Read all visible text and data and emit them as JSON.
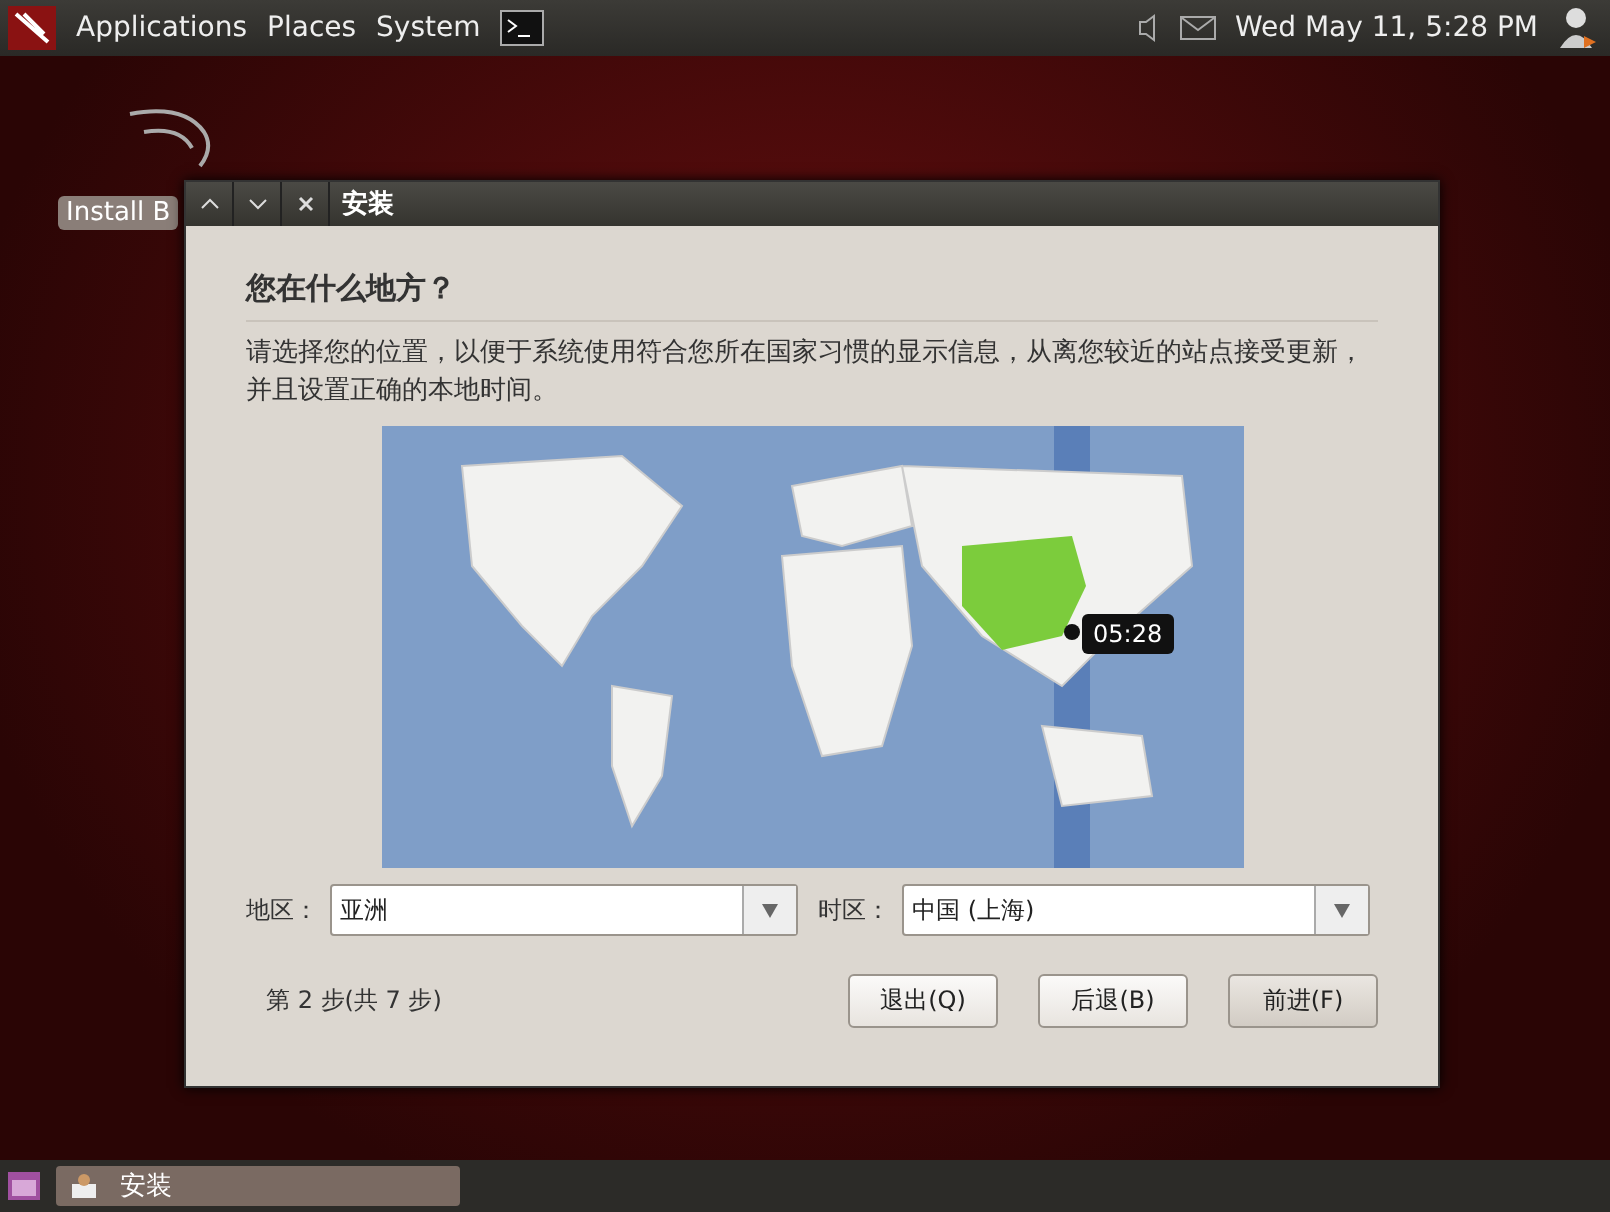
{
  "top_panel": {
    "menus": [
      "Applications",
      "Places",
      "System"
    ],
    "clock": "Wed May 11,  5:28 PM"
  },
  "desktop": {
    "icon_label": "Install B"
  },
  "window": {
    "title": "安装",
    "heading": "您在什么地方？",
    "description": "请选择您的位置，以便于系统使用符合您所在国家习惯的显示信息，从离您较近的站点接受更新，并且设置正确的本地时间。",
    "map": {
      "time": "05:28"
    },
    "region": {
      "label": "地区：",
      "value": "亚洲"
    },
    "timezone": {
      "label": "时区：",
      "value": "中国 (上海)"
    },
    "step": "第 2 步(共 7 步)",
    "buttons": [
      {
        "label": "退出(Q)",
        "selected": false
      },
      {
        "label": "后退(B)",
        "selected": false
      },
      {
        "label": "前进(F)",
        "selected": true
      }
    ]
  },
  "taskbar": {
    "items": [
      {
        "label": "安装",
        "selected": true
      }
    ]
  }
}
